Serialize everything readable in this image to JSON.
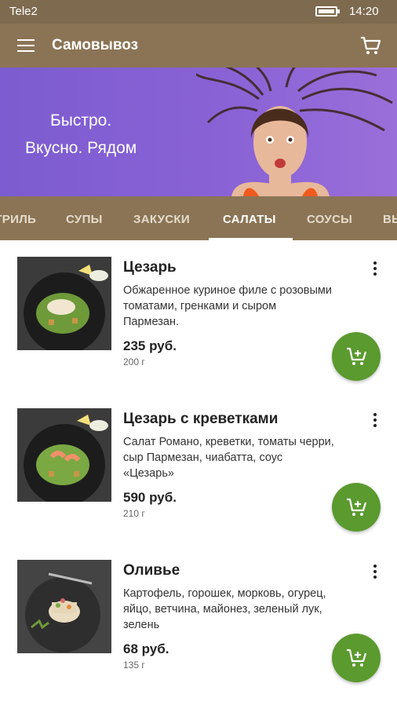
{
  "status_bar": {
    "carrier": "Tele2",
    "time": "14:20"
  },
  "app_bar": {
    "title": "Самовывоз"
  },
  "banner": {
    "line1": "Быстро.",
    "line2": "Вкусно. Рядом"
  },
  "tabs": [
    {
      "label": "ГРИЛЬ"
    },
    {
      "label": "СУПЫ"
    },
    {
      "label": "ЗАКУСКИ"
    },
    {
      "label": "САЛАТЫ",
      "active": true
    },
    {
      "label": "СОУСЫ"
    },
    {
      "label": "ВЫ"
    }
  ],
  "items": [
    {
      "title": "Цезарь",
      "description": "Обжаренное куриное филе с розовыми томатами, гренками и сыром Пармезан.",
      "price": "235 руб.",
      "weight": "200 г"
    },
    {
      "title": "Цезарь с креветками",
      "description": "Салат Романо, креветки, томаты черри, сыр Пармезан, чиабатта, соус «Цезарь»",
      "price": "590 руб.",
      "weight": "210 г"
    },
    {
      "title": "Оливье",
      "description": "Картофель, горошек, морковь, огурец, яйцо, ветчина, майонез, зеленый лук, зелень",
      "price": "68 руб.",
      "weight": "135 г"
    }
  ],
  "colors": {
    "bar": "#8b7455",
    "status": "#7d6a4f",
    "banner": "#8a63d6",
    "add_button": "#5a9a2e"
  }
}
